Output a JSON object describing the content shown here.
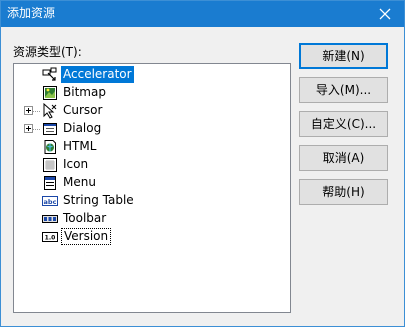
{
  "window": {
    "title": "添加资源",
    "accent": "#1a7cd0"
  },
  "resource_types": {
    "label": "资源类型(T):",
    "items": [
      {
        "label": "Accelerator",
        "icon": "accelerator-icon",
        "expandable": false,
        "selected": true
      },
      {
        "label": "Bitmap",
        "icon": "bitmap-icon",
        "expandable": false
      },
      {
        "label": "Cursor",
        "icon": "cursor-icon",
        "expandable": true
      },
      {
        "label": "Dialog",
        "icon": "dialog-icon",
        "expandable": true
      },
      {
        "label": "HTML",
        "icon": "html-icon",
        "expandable": false
      },
      {
        "label": "Icon",
        "icon": "icon-resource-icon",
        "expandable": false
      },
      {
        "label": "Menu",
        "icon": "menu-icon",
        "expandable": false
      },
      {
        "label": "String Table",
        "icon": "string-table-icon",
        "expandable": false
      },
      {
        "label": "Toolbar",
        "icon": "toolbar-icon",
        "expandable": false
      },
      {
        "label": "Version",
        "icon": "version-icon",
        "expandable": false,
        "focused": true
      }
    ]
  },
  "buttons": {
    "new": "新建(N)",
    "import": "导入(M)...",
    "custom": "自定义(C)...",
    "cancel": "取消(A)",
    "help": "帮助(H)"
  }
}
